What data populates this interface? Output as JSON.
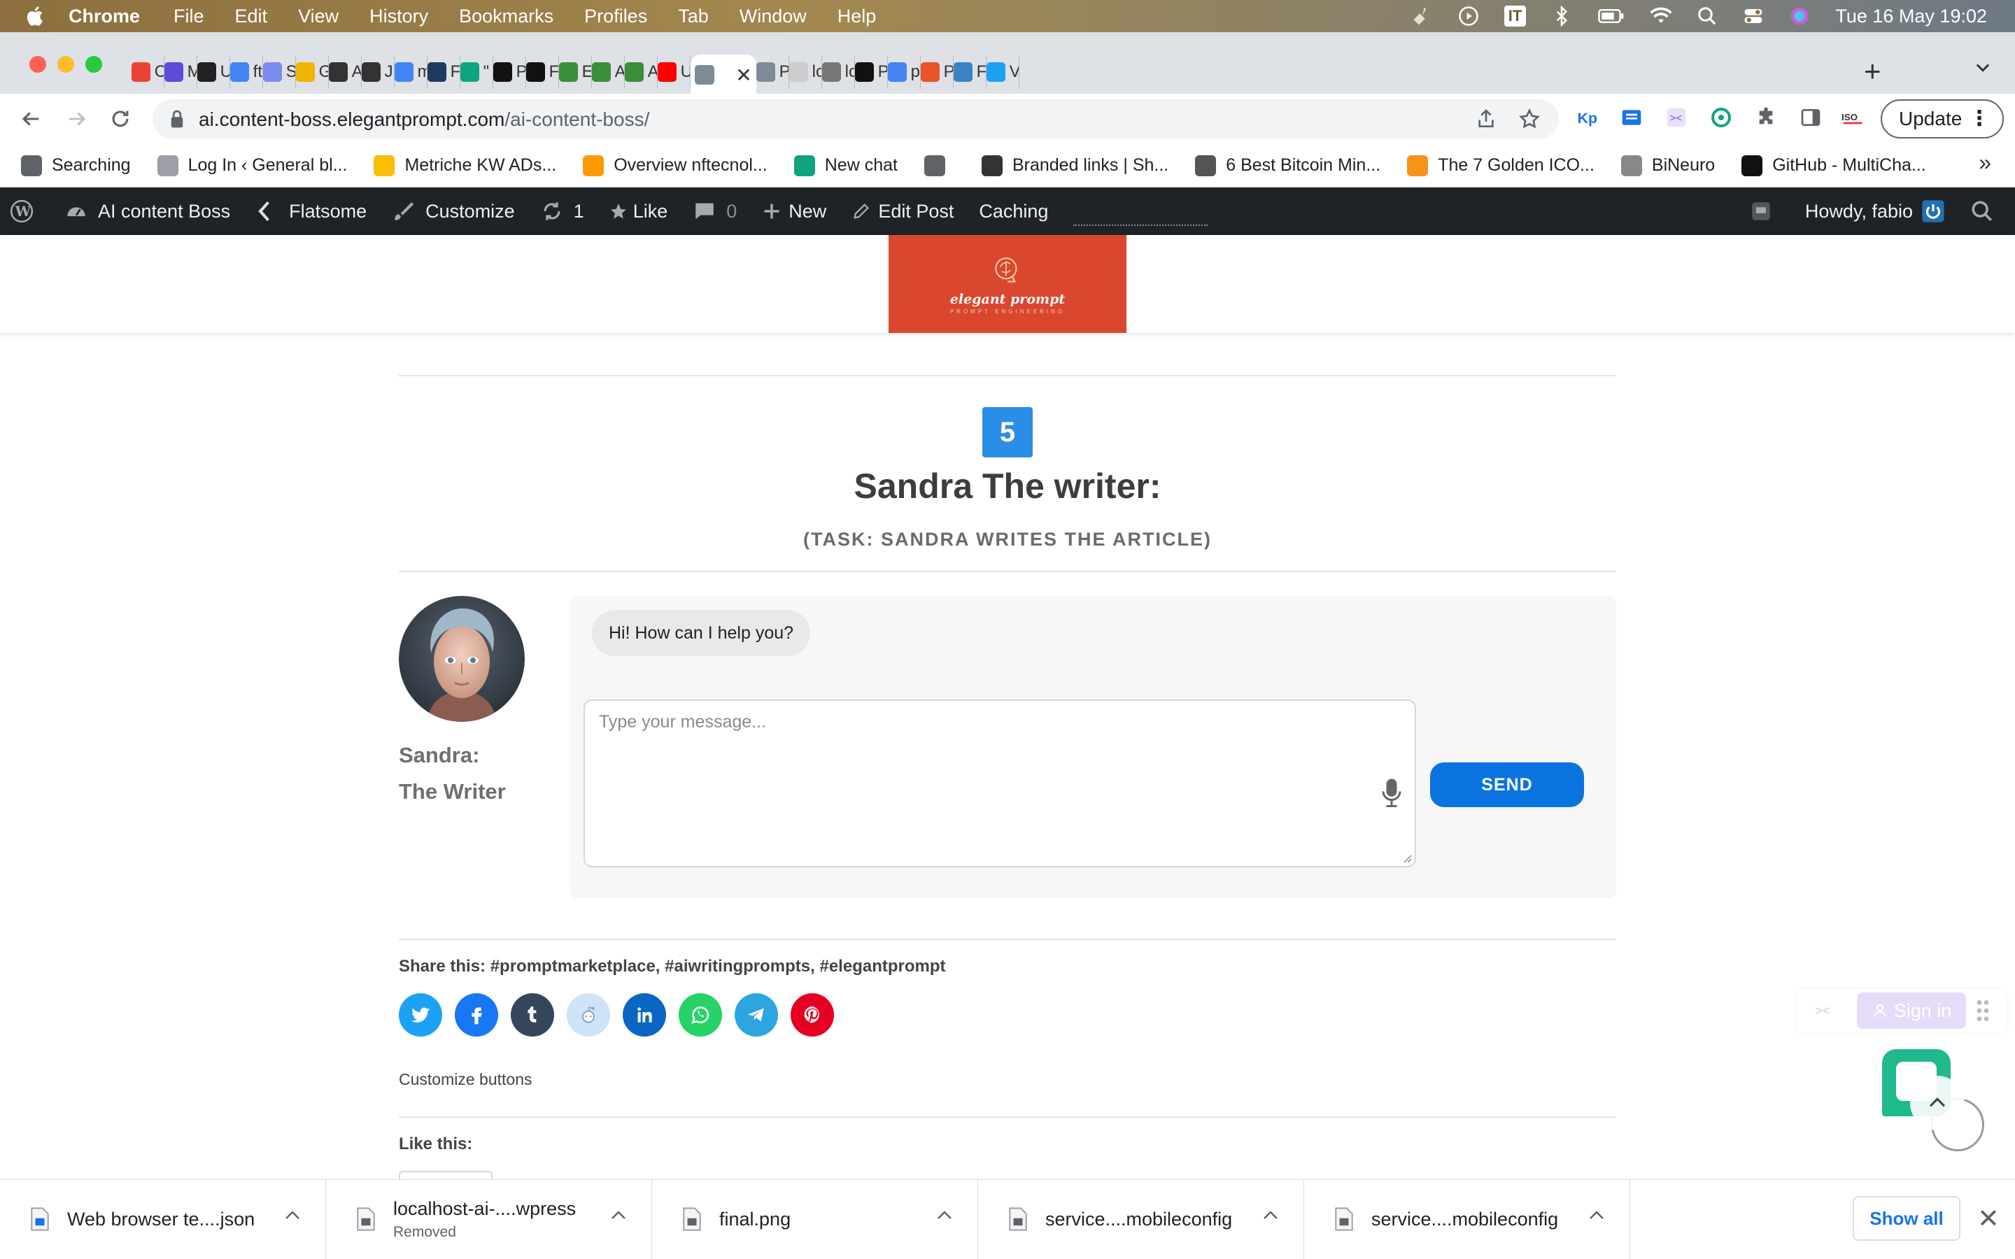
{
  "menubar": {
    "app_name": "Chrome",
    "items": [
      "File",
      "Edit",
      "View",
      "History",
      "Bookmarks",
      "Profiles",
      "Tab",
      "Window",
      "Help"
    ],
    "input_badge": "IT",
    "clock": "Tue 16 May  19:02"
  },
  "tabs": [
    {
      "label": "C",
      "icon": "gmail-icon",
      "color": "#ea4335"
    },
    {
      "label": "M",
      "icon": "app-icon",
      "color": "#5b4bdb"
    },
    {
      "label": "U",
      "icon": "openai-icon",
      "color": "#222222"
    },
    {
      "label": "ft",
      "icon": "google-icon",
      "color": "#4285f4"
    },
    {
      "label": "S",
      "icon": "ai-icon",
      "color": "#7a8cf0"
    },
    {
      "label": "G",
      "icon": "bolt-icon",
      "color": "#f0b400"
    },
    {
      "label": "A",
      "icon": "app-icon",
      "color": "#333333"
    },
    {
      "label": "J",
      "icon": "app-icon",
      "color": "#333333"
    },
    {
      "label": "m",
      "icon": "google-icon",
      "color": "#4285f4"
    },
    {
      "label": "F",
      "icon": "app-icon",
      "color": "#1e3a5f"
    },
    {
      "label": "\"",
      "icon": "openai-icon",
      "color": "#10a37f"
    },
    {
      "label": "P",
      "icon": "github-icon",
      "color": "#111111"
    },
    {
      "label": "F",
      "icon": "github-icon",
      "color": "#111111"
    },
    {
      "label": "E",
      "icon": "app-icon",
      "color": "#3a8f3a"
    },
    {
      "label": "A",
      "icon": "app-icon",
      "color": "#3a8f3a"
    },
    {
      "label": "A",
      "icon": "app-icon",
      "color": "#3a8f3a"
    },
    {
      "label": "U",
      "icon": "youtube-icon",
      "color": "#ff0000"
    },
    {
      "label": "",
      "icon": "avatar-icon",
      "color": "#7f8a99",
      "active": true
    },
    {
      "label": "P",
      "icon": "avatar-icon",
      "color": "#7f8a99"
    },
    {
      "label": "lc",
      "icon": "page-icon",
      "color": "#cccccc"
    },
    {
      "label": "lc",
      "icon": "globe-icon",
      "color": "#777777"
    },
    {
      "label": "P",
      "icon": "openai-icon",
      "color": "#111111"
    },
    {
      "label": "p",
      "icon": "google-icon",
      "color": "#4285f4"
    },
    {
      "label": "P",
      "icon": "producthunt-icon",
      "color": "#ea532a"
    },
    {
      "label": "F",
      "icon": "app-icon",
      "color": "#3b82c4"
    },
    {
      "label": "V",
      "icon": "twitter-icon",
      "color": "#1da1f2"
    }
  ],
  "address_bar": {
    "domain": "ai.content-boss.elegantprompt.com",
    "path": "/ai-content-boss/",
    "update_label": "Update"
  },
  "bookmarks": [
    {
      "label": "Searching",
      "icon": "globe-icon",
      "color": "#5f6368"
    },
    {
      "label": "Log In ‹ General bl...",
      "icon": "page-icon",
      "color": "#9aa0a6"
    },
    {
      "label": "Metriche KW ADs...",
      "icon": "google-ads-icon",
      "color": "#fbbc04"
    },
    {
      "label": "Overview nftecnol...",
      "icon": "amazon-icon",
      "color": "#ff9900"
    },
    {
      "label": "New chat",
      "icon": "openai-icon",
      "color": "#10a37f"
    },
    {
      "label": "",
      "icon": "globe-icon",
      "color": "#5f6368"
    },
    {
      "label": "Branded links | Sh...",
      "icon": "shortlink-icon",
      "color": "#333333"
    },
    {
      "label": "6 Best Bitcoin Min...",
      "icon": "pickaxe-icon",
      "color": "#555555"
    },
    {
      "label": "The 7 Golden ICO...",
      "icon": "coin-icon",
      "color": "#f7931a"
    },
    {
      "label": "BiNeuro",
      "icon": "dot-icon",
      "color": "#888888"
    },
    {
      "label": "GitHub - MultiCha...",
      "icon": "github-icon",
      "color": "#111111"
    }
  ],
  "wp_admin": {
    "site_name": "AI content Boss",
    "theme": "Flatsome",
    "customize": "Customize",
    "updates_count": "1",
    "like": "Like",
    "comments_count": "0",
    "new": "New",
    "edit_post": "Edit Post",
    "caching": "Caching",
    "howdy": "Howdy, fabio"
  },
  "logo": {
    "text": "elegant prompt",
    "subtext": "PROMPT ENGINEERING",
    "color": "#d9472f"
  },
  "agent": {
    "step": "5",
    "title": "Sandra The writer:",
    "task": "(TASK: SANDRA WRITES THE ARTICLE)",
    "name_line1": "Sandra:",
    "name_line2": "The Writer"
  },
  "chat": {
    "greeting": "Hi! How can I help you?",
    "placeholder": "Type your message...",
    "send_label": "SEND",
    "send_color": "#0b73e0"
  },
  "share": {
    "label": "Share this: #promptmarketplace, #aiwritingprompts, #elegantprompt",
    "buttons": [
      {
        "name": "twitter",
        "color": "#1da1f2"
      },
      {
        "name": "facebook",
        "color": "#1877f2"
      },
      {
        "name": "tumblr",
        "color": "#35465c"
      },
      {
        "name": "reddit",
        "color": "#cee3f8"
      },
      {
        "name": "linkedin",
        "color": "#0a66c2"
      },
      {
        "name": "whatsapp",
        "color": "#25d366"
      },
      {
        "name": "telegram",
        "color": "#2ca5e0"
      },
      {
        "name": "pinterest",
        "color": "#e60023"
      }
    ],
    "customize_label": "Customize buttons",
    "like_label": "Like this:"
  },
  "widgets": {
    "sign_in": "Sign in"
  },
  "downloads": {
    "items": [
      {
        "name": "Web browser te....json",
        "status": ""
      },
      {
        "name": "localhost-ai-....wpress",
        "status": "Removed"
      },
      {
        "name": "final.png",
        "status": ""
      },
      {
        "name": "service....mobileconfig",
        "status": ""
      },
      {
        "name": "service....mobileconfig",
        "status": ""
      }
    ],
    "show_all": "Show all"
  }
}
